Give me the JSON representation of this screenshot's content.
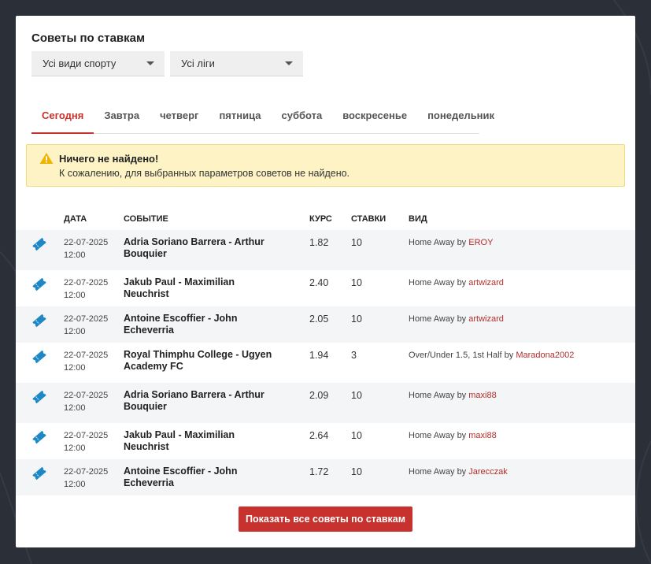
{
  "page": {
    "title": "Советы по ставкам"
  },
  "filters": {
    "sport": "Усі види спорту",
    "league": "Усі ліги"
  },
  "tabs": [
    {
      "label": "Сегодня",
      "active": true
    },
    {
      "label": "Завтра",
      "active": false
    },
    {
      "label": "четверг",
      "active": false
    },
    {
      "label": "пятница",
      "active": false
    },
    {
      "label": "суббота",
      "active": false
    },
    {
      "label": "воскресенье",
      "active": false
    },
    {
      "label": "понедельник",
      "active": false
    }
  ],
  "alert": {
    "icon": "warning-icon",
    "title": "Ничего не найдено!",
    "text": "К сожалению, для выбранных параметров советов не найдено."
  },
  "table": {
    "headers": {
      "date": "Дата",
      "event": "Событие",
      "odds": "Курс",
      "stakes": "Ставки",
      "kind": "Вид"
    },
    "by_word": "by",
    "rows": [
      {
        "date": "22-07-2025",
        "time": "12:00",
        "event": "Adria Soriano Barrera - Arthur Bouquier",
        "odds": "1.82",
        "stakes": "10",
        "kind": "Home Away",
        "user": "EROY"
      },
      {
        "date": "22-07-2025",
        "time": "12:00",
        "event": "Jakub Paul - Maximilian Neuchrist",
        "odds": "2.40",
        "stakes": "10",
        "kind": "Home Away",
        "user": "artwizard"
      },
      {
        "date": "22-07-2025",
        "time": "12:00",
        "event": "Antoine Escoffier - John Echeverria",
        "odds": "2.05",
        "stakes": "10",
        "kind": "Home Away",
        "user": "artwizard"
      },
      {
        "date": "22-07-2025",
        "time": "12:00",
        "event": "Royal Thimphu College - Ugyen Academy FC",
        "odds": "1.94",
        "stakes": "3",
        "kind": "Over/Under 1.5, 1st Half",
        "user": "Maradona2002"
      },
      {
        "date": "22-07-2025",
        "time": "12:00",
        "event": "Adria Soriano Barrera - Arthur Bouquier",
        "odds": "2.09",
        "stakes": "10",
        "kind": "Home Away",
        "user": "maxi88"
      },
      {
        "date": "22-07-2025",
        "time": "12:00",
        "event": "Jakub Paul - Maximilian Neuchrist",
        "odds": "2.64",
        "stakes": "10",
        "kind": "Home Away",
        "user": "maxi88"
      },
      {
        "date": "22-07-2025",
        "time": "12:00",
        "event": "Antoine Escoffier - John Echeverria",
        "odds": "1.72",
        "stakes": "10",
        "kind": "Home Away",
        "user": "Jarecczak"
      }
    ]
  },
  "button": {
    "label": "Показать все советы по ставкам"
  },
  "colors": {
    "accent": "#c8322e",
    "ticket": "#1e88c7",
    "alert_bg": "#fdf3c5",
    "page_bg": "#2b2f38"
  }
}
